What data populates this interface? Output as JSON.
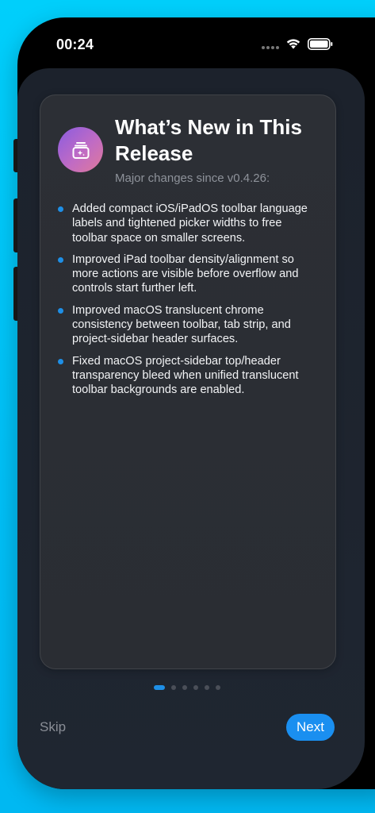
{
  "status_bar": {
    "time": "00:24"
  },
  "card": {
    "icon": "sparkle-box-icon",
    "title": "What’s New in This Release",
    "subtitle": "Major changes since v0.4.26:",
    "changes": [
      "Added compact iOS/iPadOS toolbar language labels and tightened picker widths to free toolbar space on smaller screens.",
      "Improved iPad toolbar density/alignment so more actions are visible before overflow and controls start further left.",
      "Improved macOS translucent chrome consistency between toolbar, tab strip, and project-sidebar header surfaces.",
      "Fixed macOS project-sidebar top/header transparency bleed when unified translucent toolbar backgrounds are enabled."
    ]
  },
  "pager": {
    "total_pages": 6,
    "current_page": 1
  },
  "footer": {
    "skip_label": "Skip",
    "next_label": "Next"
  },
  "colors": {
    "accent": "#1a8ff0",
    "sheet_background": "#1c222c",
    "card_background": "#2c2f35",
    "page_background": "#00c8f8"
  }
}
